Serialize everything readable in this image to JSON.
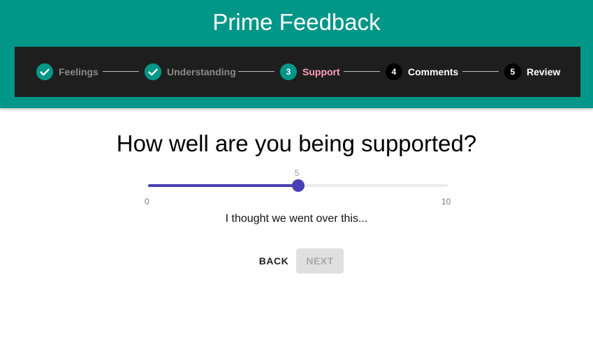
{
  "app": {
    "title": "Prime Feedback"
  },
  "stepper": {
    "steps": [
      {
        "number": "1",
        "label": "Feelings",
        "state": "completed",
        "icon": "check-icon"
      },
      {
        "number": "2",
        "label": "Understanding",
        "state": "completed",
        "icon": "check-icon"
      },
      {
        "number": "3",
        "label": "Support",
        "state": "active"
      },
      {
        "number": "4",
        "label": "Comments",
        "state": "upcoming"
      },
      {
        "number": "5",
        "label": "Review",
        "state": "upcoming"
      }
    ]
  },
  "question": {
    "text": "How well are you being supported?"
  },
  "slider": {
    "min": 0,
    "max": 10,
    "value": 5,
    "min_label": "0",
    "max_label": "10",
    "value_label": "5"
  },
  "feedback": {
    "text": "I thought we went over this..."
  },
  "buttons": {
    "back_label": "BACK",
    "next_label": "NEXT",
    "next_disabled": true
  },
  "colors": {
    "header": "#009688",
    "stepper_background": "#1e1e1e",
    "active_step_label": "#ff9fb8",
    "slider_accent": "#4a3fb5"
  }
}
